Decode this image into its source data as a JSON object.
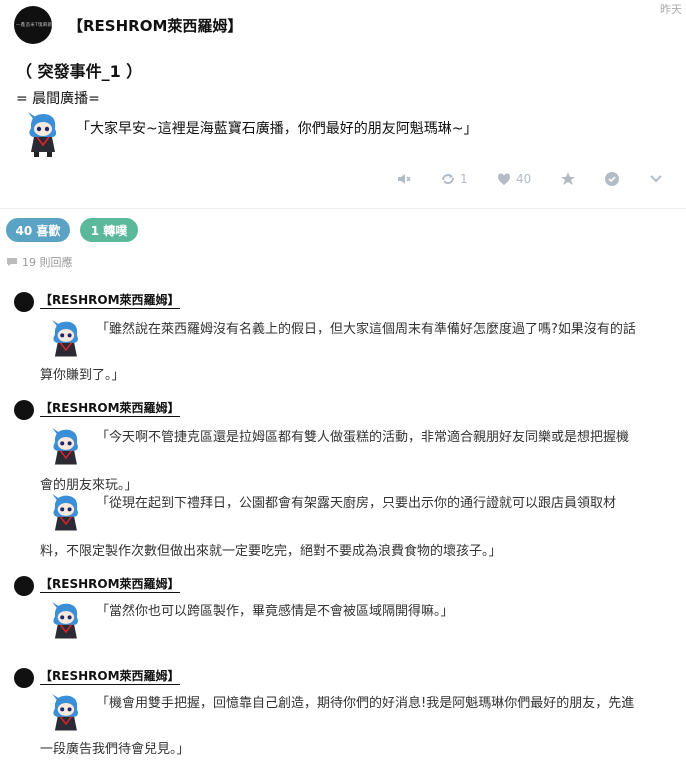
{
  "post": {
    "author": "【RESHROM萊西羅姆】",
    "time": "昨天",
    "avatar_text": "一鑫造米T瑰麻鋼",
    "event_title": "（ 突發事件_1 ）",
    "sub_title": "= 晨間廣播=",
    "quote": "「大家早安~這裡是海藍寶石廣播，你們最好的朋友阿魁瑪琳~」"
  },
  "toolbar": {
    "share_count": "1",
    "like_count": "40"
  },
  "badges": {
    "likes": "40 喜歡",
    "shares": "1 轉噗"
  },
  "reply_count": "19 則回應",
  "comments": [
    {
      "author": "【RESHROM萊西羅姆】",
      "line1": "「雖然說在萊西羅姆沒有名義上的假日，但大家這個周末有準備好怎麼度過了嗎?如果沒有的話",
      "line2": "算你賺到了。」"
    },
    {
      "author": "【RESHROM萊西羅姆】",
      "line1": "「今天啊不管捷克區還是拉姆區都有雙人做蛋糕的活動，非常適合親朋好友同樂或是想把握機",
      "line2": "會的朋友來玩。」",
      "line3": "「從現在起到下禮拜日，公園都會有架露天廚房，只要出示你的通行證就可以跟店員領取材",
      "line4": "料，不限定製作次數但做出來就一定要吃完，絕對不要成為浪費食物的壞孩子。」"
    },
    {
      "author": "【RESHROM萊西羅姆】",
      "line1": "「當然你也可以跨區製作，畢竟感情是不會被區域隔開得嘛。」"
    },
    {
      "author": "【RESHROM萊西羅姆】",
      "line1": "「機會用雙手把握，回憶靠自己創造，期待你們的好消息!我是阿魁瑪琳你們最好的朋友，先進",
      "line2": "一段廣告我們待會兒見。」"
    }
  ],
  "colors": {
    "likes_badge": "#5aa3c4",
    "shares_badge": "#5bb89a",
    "toolbar_icon": "#b3bcc6",
    "mascot_hair": "#3a8fd6"
  }
}
